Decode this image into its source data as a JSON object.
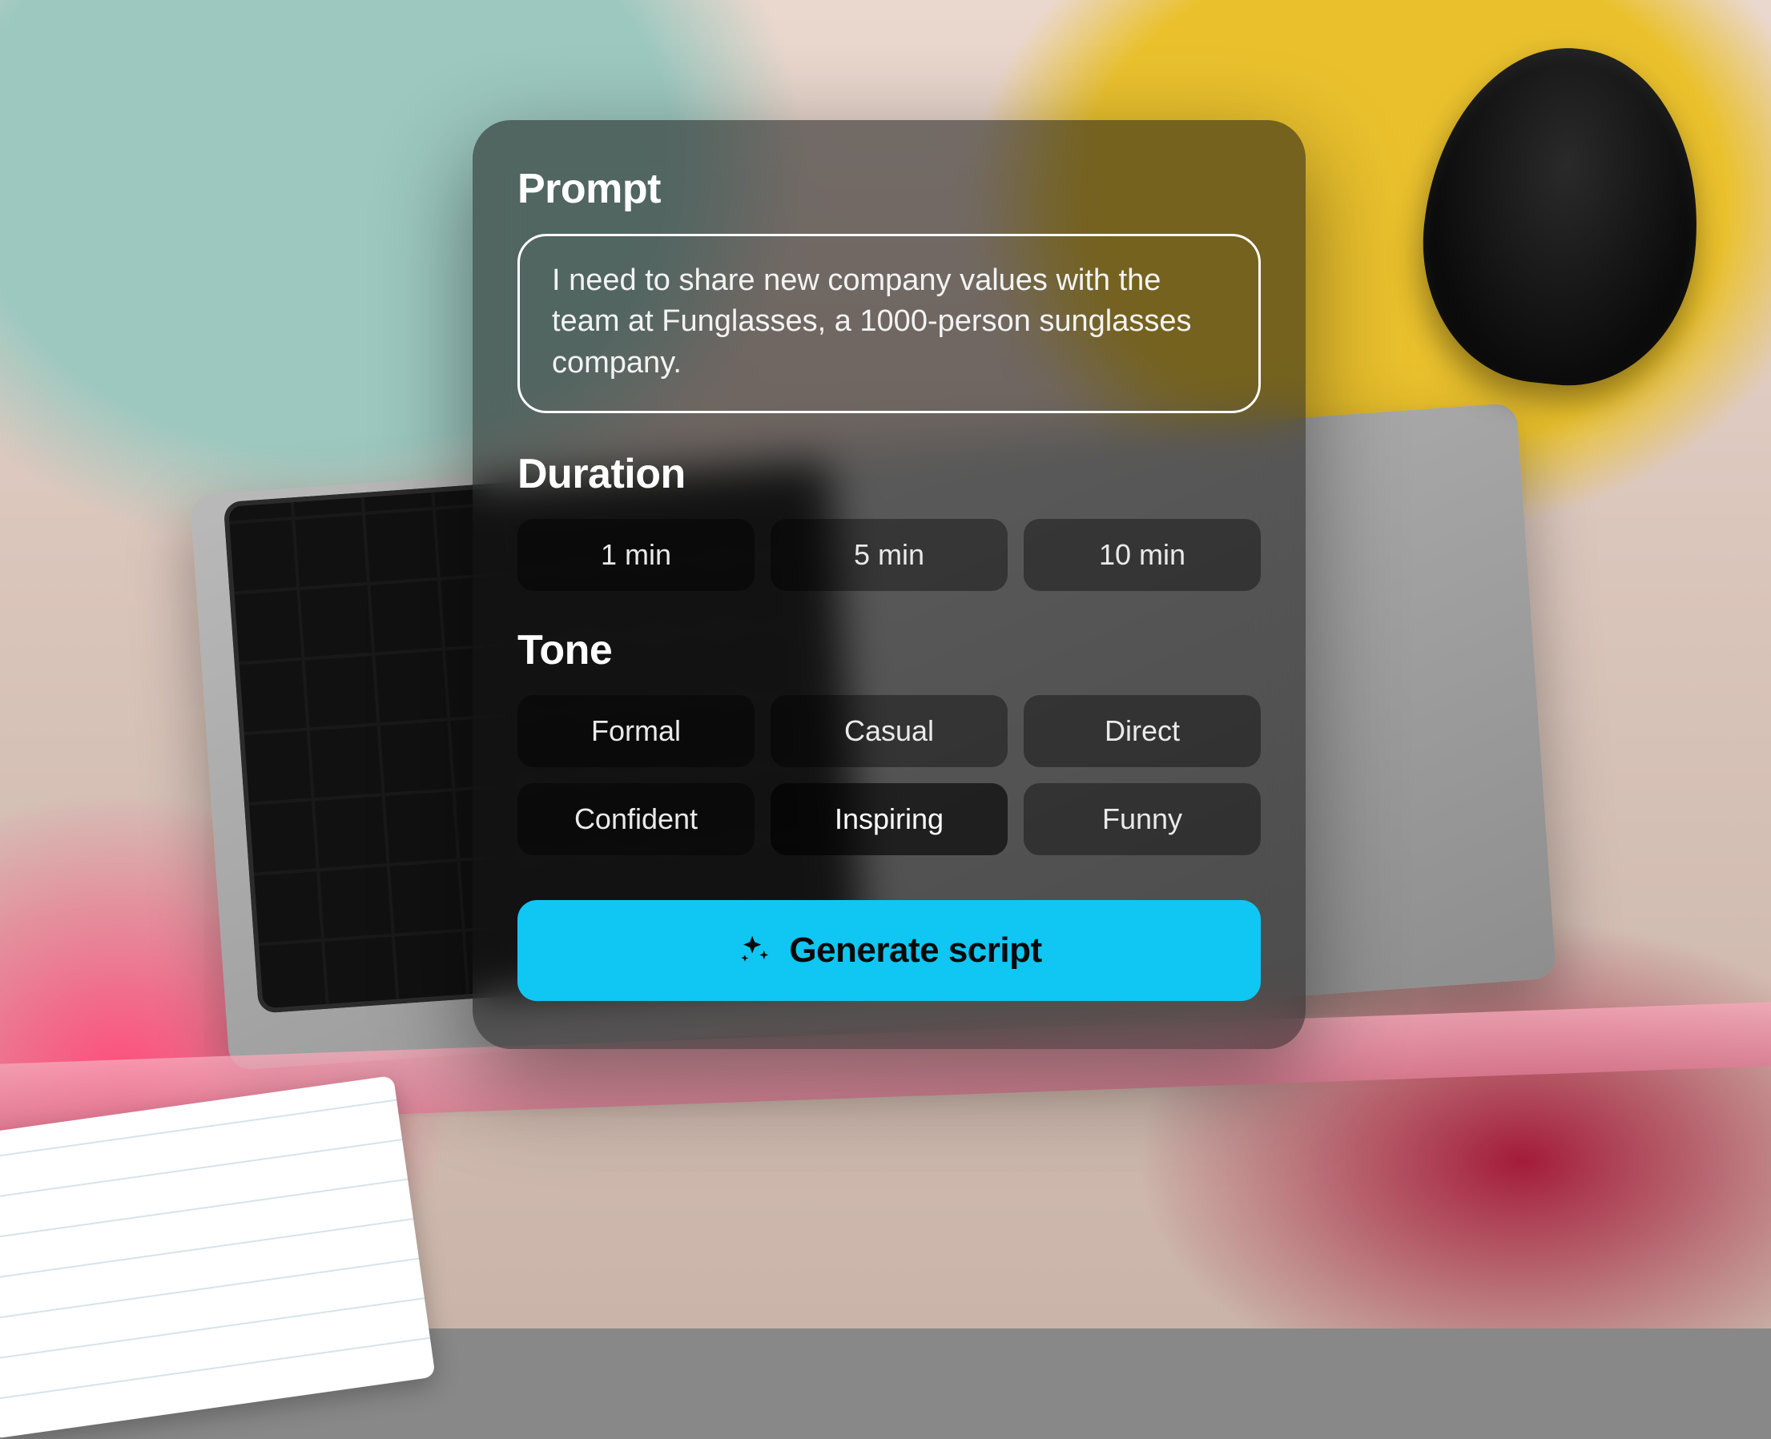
{
  "prompt": {
    "title": "Prompt",
    "text": "I need to share new company values with the team at Funglasses, a 1000-person sunglasses company."
  },
  "duration": {
    "title": "Duration",
    "options": [
      "1 min",
      "5 min",
      "10 min"
    ],
    "selected_index": null
  },
  "tone": {
    "title": "Tone",
    "options": [
      "Formal",
      "Casual",
      "Direct",
      "Confident",
      "Inspiring",
      "Funny"
    ],
    "selected_index": 4
  },
  "actions": {
    "generate_label": "Generate script"
  },
  "colors": {
    "accent": "#10c6f2",
    "card_bg": "rgba(20,20,20,0.55)"
  }
}
